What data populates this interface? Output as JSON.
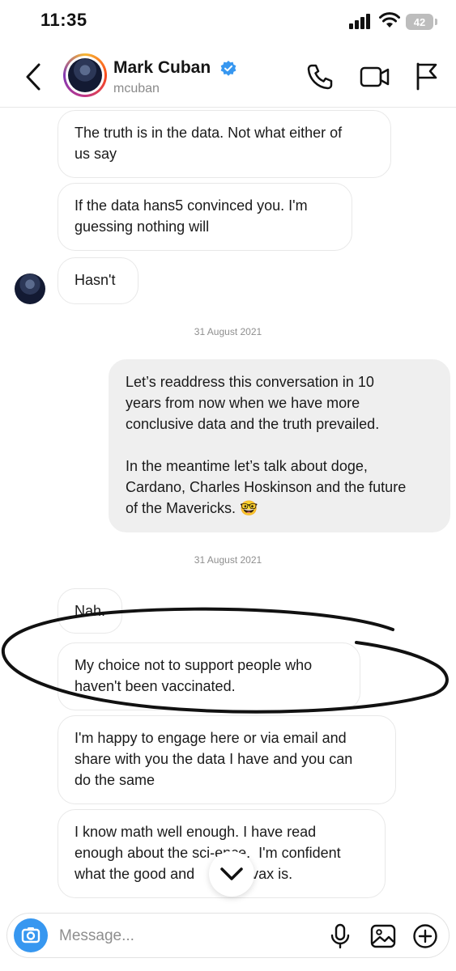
{
  "status_bar": {
    "time": "11:35",
    "battery": "42"
  },
  "header": {
    "name": "Mark Cuban",
    "handle": "mcuban",
    "verified": true,
    "icons": [
      "back-icon",
      "phone-icon",
      "video-icon",
      "flag-icon"
    ]
  },
  "messages": [
    {
      "from": "other",
      "text": "The truth is in the data. Not what either of\nus say"
    },
    {
      "from": "other",
      "text": "If the data hans5 convinced you. I'm\nguessing nothing will"
    },
    {
      "from": "other",
      "text": "Hasn't"
    },
    {
      "type": "date",
      "text": "31 August 2021"
    },
    {
      "from": "me",
      "text": "Let’s readdress this conversation in 10\nyears from now when we have more\nconclusive data and the truth prevailed.\n\nIn the meantime let’s talk about doge,\nCardano, Charles Hoskinson and the future\nof the Mavericks. 🤓"
    },
    {
      "type": "date",
      "text": "31 August 2021"
    },
    {
      "from": "other",
      "text": "Nah."
    },
    {
      "from": "other",
      "text": "My choice not to support people who\nhaven't been vaccinated."
    },
    {
      "from": "other",
      "text": "I'm happy to engage here or via email and\nshare with you the data I have and you can\ndo the same"
    },
    {
      "from": "other",
      "text": "I know math well enough. I have read\nenough about the sci-ence.  I'm confident\nwhat the good and      f the vax is."
    }
  ],
  "composer": {
    "placeholder": "Message..."
  },
  "colors": {
    "accent": "#3797f0",
    "sent_bubble": "#efefef",
    "verified": "#3797f0"
  }
}
